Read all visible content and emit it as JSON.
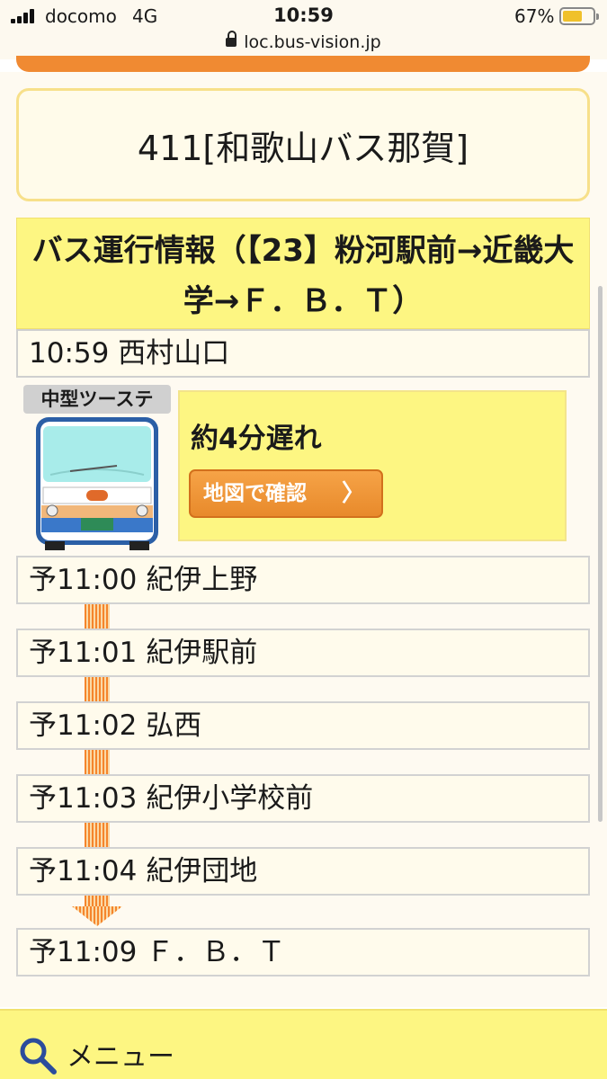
{
  "status_bar": {
    "carrier": "docomo",
    "network": "4G",
    "time": "10:59",
    "battery_percent": "67%",
    "battery_level": 0.67
  },
  "url": "loc.bus-vision.jp",
  "route": {
    "title": "411[和歌山バス那賀]"
  },
  "info": {
    "header": "バス運行情報（【23】粉河駅前→近畿大学→Ｆ．Ｂ．Ｔ）"
  },
  "current": {
    "label": "10:59 西村山口"
  },
  "bus": {
    "type_label": "中型ツーステ",
    "delay": "約4分遅れ",
    "map_button": "地図で確認",
    "map_chevron": "〉"
  },
  "stops": [
    {
      "label": "予11:00 紀伊上野"
    },
    {
      "label": "予11:01 紀伊駅前"
    },
    {
      "label": "予11:02 弘西"
    },
    {
      "label": "予11:03 紀伊小学校前"
    },
    {
      "label": "予11:04 紀伊団地"
    },
    {
      "label": "予11:09 Ｆ．Ｂ．Ｔ"
    }
  ],
  "footer": {
    "menu_label": "メニュー"
  },
  "colors": {
    "accent_orange": "#f08a32",
    "info_yellow": "#fdf682",
    "route_border": "#f7e08a",
    "row_bg": "#fffbec"
  }
}
